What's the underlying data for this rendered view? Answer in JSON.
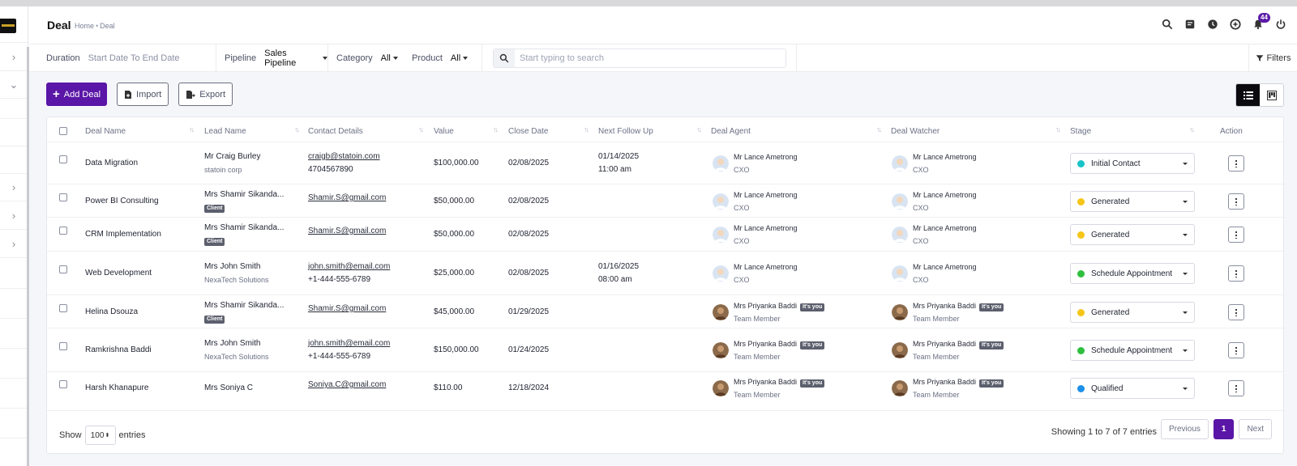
{
  "header": {
    "title": "Deal",
    "breadcrumb": [
      "Home",
      "Deal"
    ],
    "notification_count": "44"
  },
  "filters": {
    "duration_label": "Duration",
    "duration_value": "Start Date To End Date",
    "pipeline_label": "Pipeline",
    "pipeline_value": "Sales Pipeline",
    "category_label": "Category",
    "category_value": "All",
    "product_label": "Product",
    "product_value": "All",
    "search_placeholder": "Start typing to search",
    "filters_label": "Filters"
  },
  "toolbar": {
    "add_label": "Add Deal",
    "import_label": "Import",
    "export_label": "Export"
  },
  "table": {
    "columns": [
      "Deal Name",
      "Lead Name",
      "Contact Details",
      "Value",
      "Close Date",
      "Next Follow Up",
      "Deal Agent",
      "Deal Watcher",
      "Stage",
      "Action"
    ],
    "rows": [
      {
        "deal": "Data Migration",
        "lead": "Mr Craig Burley",
        "lead_sub": "statoin corp",
        "client": "",
        "email": "craigb@statoin.com",
        "phone": "4704567890",
        "value": "$100,000.00",
        "close": "02/08/2025",
        "follow_date": "01/14/2025",
        "follow_time": "11:00 am",
        "agent": "Mr Lance Ametrong",
        "agent_role": "CXO",
        "agent_you": "",
        "watcher": "Mr Lance Ametrong",
        "watcher_role": "CXO",
        "watcher_you": "",
        "stage": "Initial Contact",
        "stage_color": "#17c3c9"
      },
      {
        "deal": "Power BI Consulting",
        "lead": "Mrs Shamir Sikanda...",
        "lead_sub": "",
        "client": "Client",
        "email": "Shamir.S@gmail.com",
        "phone": "",
        "value": "$50,000.00",
        "close": "02/08/2025",
        "follow_date": "",
        "follow_time": "",
        "agent": "Mr Lance Ametrong",
        "agent_role": "CXO",
        "agent_you": "",
        "watcher": "Mr Lance Ametrong",
        "watcher_role": "CXO",
        "watcher_you": "",
        "stage": "Generated",
        "stage_color": "#f5c518"
      },
      {
        "deal": "CRM Implementation",
        "lead": "Mrs Shamir Sikanda...",
        "lead_sub": "",
        "client": "Client",
        "email": "Shamir.S@gmail.com",
        "phone": "",
        "value": "$50,000.00",
        "close": "02/08/2025",
        "follow_date": "",
        "follow_time": "",
        "agent": "Mr Lance Ametrong",
        "agent_role": "CXO",
        "agent_you": "",
        "watcher": "Mr Lance Ametrong",
        "watcher_role": "CXO",
        "watcher_you": "",
        "stage": "Generated",
        "stage_color": "#f5c518"
      },
      {
        "deal": "Web Development",
        "lead": "Mrs John Smith",
        "lead_sub": "NexaTech Solutions",
        "client": "",
        "email": "john.smith@email.com",
        "phone": "+1-444-555-6789",
        "value": "$25,000.00",
        "close": "02/08/2025",
        "follow_date": "01/16/2025",
        "follow_time": "08:00 am",
        "agent": "Mr Lance Ametrong",
        "agent_role": "CXO",
        "agent_you": "",
        "watcher": "Mr Lance Ametrong",
        "watcher_role": "CXO",
        "watcher_you": "",
        "stage": "Schedule Appointment",
        "stage_color": "#2fbf3f"
      },
      {
        "deal": "Helina Dsouza",
        "lead": "Mrs Shamir Sikanda...",
        "lead_sub": "",
        "client": "Client",
        "email": "Shamir.S@gmail.com",
        "phone": "",
        "value": "$45,000.00",
        "close": "01/29/2025",
        "follow_date": "",
        "follow_time": "",
        "agent": "Mrs Priyanka Baddi",
        "agent_role": "Team Member",
        "agent_you": "It's you",
        "watcher": "Mrs Priyanka Baddi",
        "watcher_role": "Team Member",
        "watcher_you": "It's you",
        "stage": "Generated",
        "stage_color": "#f5c518"
      },
      {
        "deal": "Ramkrishna Baddi",
        "lead": "Mrs John Smith",
        "lead_sub": "NexaTech Solutions",
        "client": "",
        "email": "john.smith@email.com",
        "phone": "+1-444-555-6789",
        "value": "$150,000.00",
        "close": "01/24/2025",
        "follow_date": "",
        "follow_time": "",
        "agent": "Mrs Priyanka Baddi",
        "agent_role": "Team Member",
        "agent_you": "It's you",
        "watcher": "Mrs Priyanka Baddi",
        "watcher_role": "Team Member",
        "watcher_you": "It's you",
        "stage": "Schedule Appointment",
        "stage_color": "#2fbf3f"
      },
      {
        "deal": "Harsh Khanapure",
        "lead": "Mrs Soniya C",
        "lead_sub": "",
        "client": "",
        "email": "Soniya.C@gmail.com",
        "phone": "",
        "value": "$110.00",
        "close": "12/18/2024",
        "follow_date": "",
        "follow_time": "",
        "agent": "Mrs Priyanka Baddi",
        "agent_role": "Team Member",
        "agent_you": "It's you",
        "watcher": "Mrs Priyanka Baddi",
        "watcher_role": "Team Member",
        "watcher_you": "It's you",
        "stage": "Qualified",
        "stage_color": "#1e90e8"
      }
    ]
  },
  "footer": {
    "show_label": "Show",
    "length_value": "100",
    "entries_label": "entries",
    "info": "Showing 1 to 7 of 7 entries",
    "previous": "Previous",
    "page": "1",
    "next": "Next"
  },
  "colors": {
    "accent": "#5a16a6",
    "avatar_cxo": "#d9e4f2",
    "avatar_member": "#8a6a4a"
  }
}
